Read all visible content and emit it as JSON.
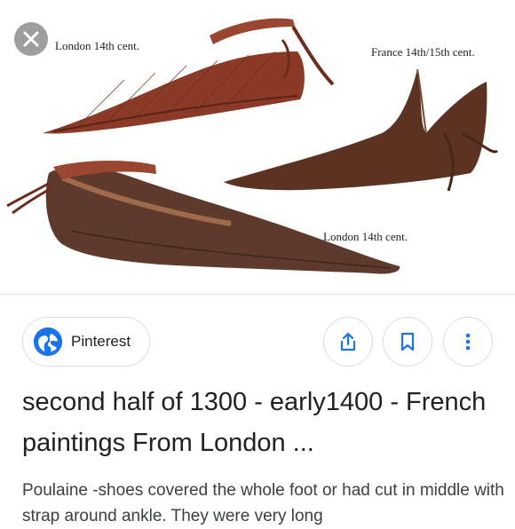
{
  "image": {
    "captions": {
      "top_left": "London 14th cent.",
      "top_right": "France 14th/15th cent.",
      "bottom": "London 14th cent."
    }
  },
  "close_button": {
    "icon": "close-icon"
  },
  "source": {
    "name": "Pinterest",
    "icon": "globe-icon"
  },
  "actions": [
    {
      "name": "share",
      "icon": "share-icon"
    },
    {
      "name": "save",
      "icon": "bookmark-icon"
    },
    {
      "name": "more",
      "icon": "more-vert-icon"
    }
  ],
  "result": {
    "title": "second half of 1300 - early1400 - French paintings From London ...",
    "description": "Poulaine -shoes covered the whole foot or had cut in middle with strap around ankle. They were very long"
  },
  "colors": {
    "accent": "#1a73e8",
    "leather_dark": "#5c3322",
    "leather_red": "#8a3a26",
    "close_bg": "#9e9e9e"
  }
}
